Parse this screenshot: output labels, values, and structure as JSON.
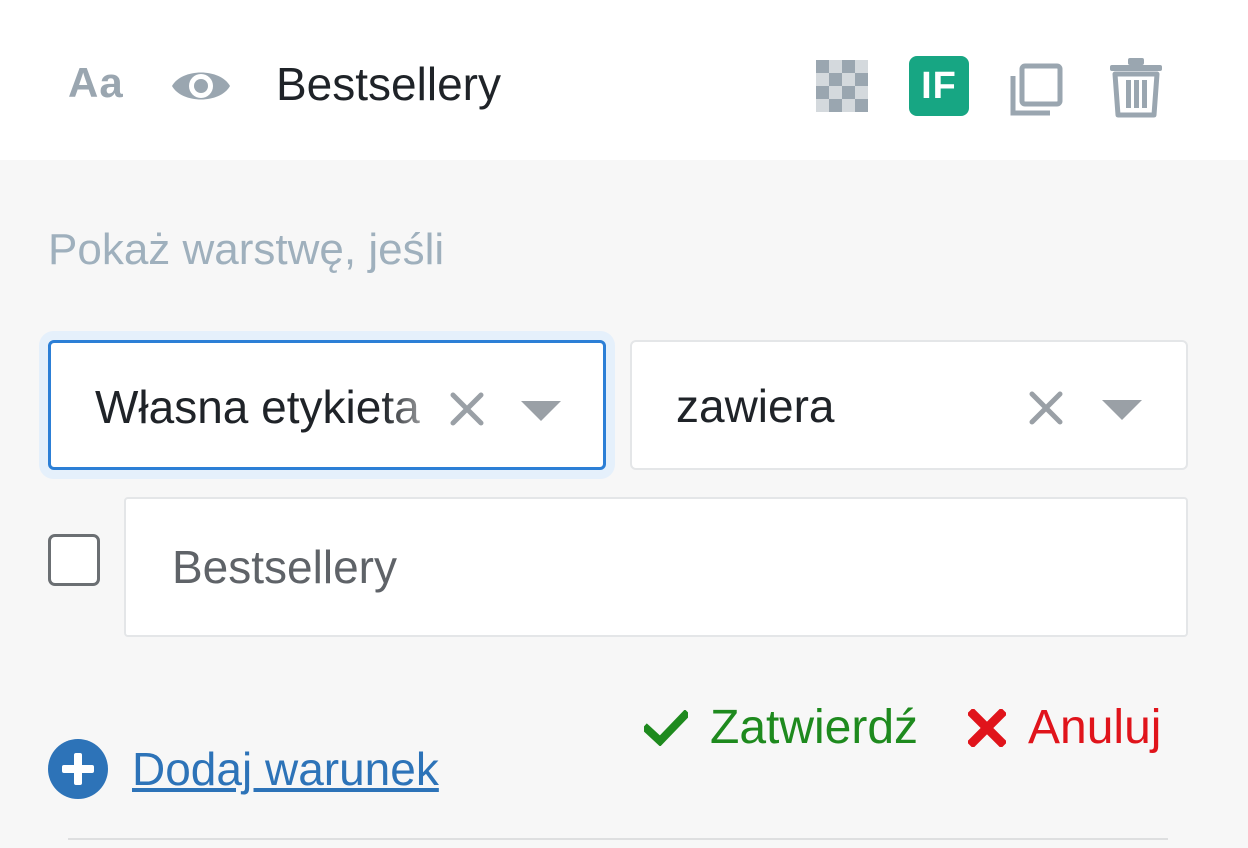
{
  "header": {
    "text_style_label": "Aa",
    "layer_name": "Bestsellery",
    "if_badge": "IF",
    "icons": [
      "text-style-icon",
      "eye-icon",
      "checkerboard-icon",
      "if-badge",
      "copy-icon",
      "trash-icon"
    ]
  },
  "condition": {
    "label": "Pokaż warstwę, jeśli",
    "field_select": "Własna etykieta",
    "operator_select": "zawiera",
    "value_input": "Bestsellery",
    "checkbox_checked": false
  },
  "actions": {
    "confirm_label": "Zatwierdź",
    "cancel_label": "Anuluj",
    "add_condition_label": "Dodaj warunek"
  },
  "colors": {
    "accent_blue": "#2c7fd6",
    "if_badge_green": "#17a683",
    "confirm_green": "#1e8a1e",
    "cancel_red": "#e0141b",
    "link_blue": "#2d73b8"
  }
}
